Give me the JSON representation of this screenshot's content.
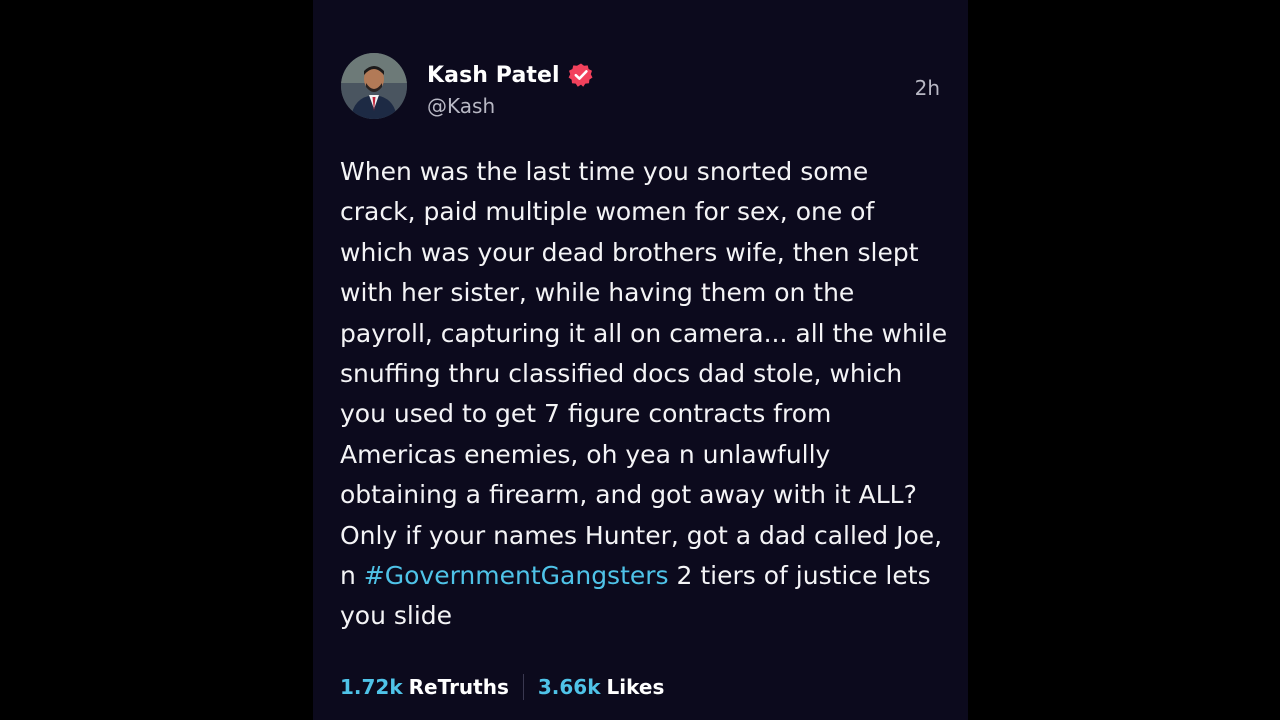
{
  "post": {
    "author": {
      "display_name": "Kash Patel",
      "handle": "@Kash",
      "verified": true,
      "verified_badge_color": "#f2415c"
    },
    "timestamp": "2h",
    "text_before_hashtag": "When was the last time you snorted some crack, paid multiple women for sex, one of which was your dead brothers wife, then slept with her sister, while having them on the payroll, capturing it all on camera... all the while snuffing thru classified docs dad stole, which you used to get 7 figure contracts from Americas enemies, oh yea n unlawfully obtaining a firearm, and got away with it ALL? Only if your names Hunter, got a dad called Joe, n ",
    "hashtag": "#GovernmentGangsters",
    "text_after_hashtag": " 2 tiers of justice lets you slide",
    "stats": {
      "retruths_count": "1.72k",
      "retruths_label": "ReTruths",
      "likes_count": "3.66k",
      "likes_label": "Likes"
    }
  },
  "colors": {
    "page_background": "#000000",
    "card_background": "#0c0a1d",
    "accent": "#4fc3e8",
    "primary_text": "#f4f4f6",
    "secondary_text": "#b8b8c4"
  }
}
